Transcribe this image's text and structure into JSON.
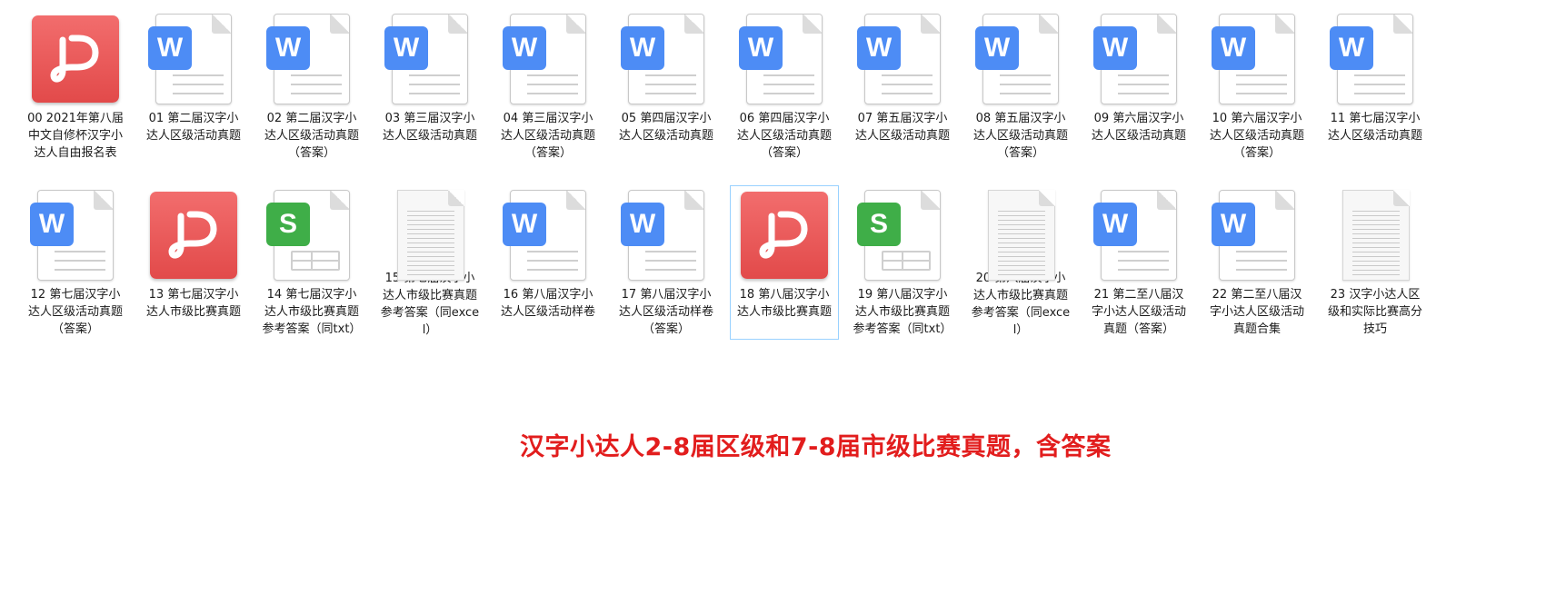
{
  "files": [
    {
      "type": "pdf",
      "label": "00 2021年第八届中文自修杯汉字小达人自由报名表"
    },
    {
      "type": "word",
      "label": "01 第二届汉字小达人区级活动真题"
    },
    {
      "type": "word",
      "label": "02 第二届汉字小达人区级活动真题（答案）"
    },
    {
      "type": "word",
      "label": "03 第三届汉字小达人区级活动真题"
    },
    {
      "type": "word",
      "label": "04 第三届汉字小达人区级活动真题（答案）"
    },
    {
      "type": "word",
      "label": "05 第四届汉字小达人区级活动真题"
    },
    {
      "type": "word",
      "label": "06 第四届汉字小达人区级活动真题（答案）"
    },
    {
      "type": "word",
      "label": "07 第五届汉字小达人区级活动真题"
    },
    {
      "type": "word",
      "label": "08 第五届汉字小达人区级活动真题（答案）"
    },
    {
      "type": "word",
      "label": "09 第六届汉字小达人区级活动真题"
    },
    {
      "type": "word",
      "label": "10 第六届汉字小达人区级活动真题（答案）"
    },
    {
      "type": "word",
      "label": "11 第七届汉字小达人区级活动真题"
    },
    {
      "type": "word",
      "label": "12 第七届汉字小达人区级活动真题（答案）"
    },
    {
      "type": "pdf",
      "label": "13 第七届汉字小达人市级比赛真题"
    },
    {
      "type": "sheet",
      "label": "14 第七届汉字小达人市级比赛真题参考答案（同txt）"
    },
    {
      "type": "text",
      "label": "15 第七届汉字小达人市级比赛真题参考答案（同excel）"
    },
    {
      "type": "word",
      "label": "16 第八届汉字小达人区级活动样卷"
    },
    {
      "type": "word",
      "label": "17 第八届汉字小达人区级活动样卷（答案）"
    },
    {
      "type": "pdf",
      "label": "18 第八届汉字小达人市级比赛真题",
      "selected": true
    },
    {
      "type": "sheet",
      "label": "19 第八届汉字小达人市级比赛真题参考答案（同txt）"
    },
    {
      "type": "text",
      "label": "20 第八届汉字小达人市级比赛真题参考答案（同excel）"
    },
    {
      "type": "word",
      "label": "21 第二至八届汉字小达人区级活动真题（答案）"
    },
    {
      "type": "word",
      "label": "22 第二至八届汉字小达人区级活动真题合集"
    },
    {
      "type": "text",
      "label": "23 汉字小达人区级和实际比赛高分技巧"
    }
  ],
  "icons": {
    "word_letter": "W",
    "sheet_letter": "S"
  },
  "colors": {
    "word": "#4d8cf5",
    "sheet": "#3fae48",
    "pdf": "#e8504f",
    "caption": "#e21d1d"
  },
  "caption": "汉字小达人2-8届区级和7-8届市级比赛真题，含答案"
}
